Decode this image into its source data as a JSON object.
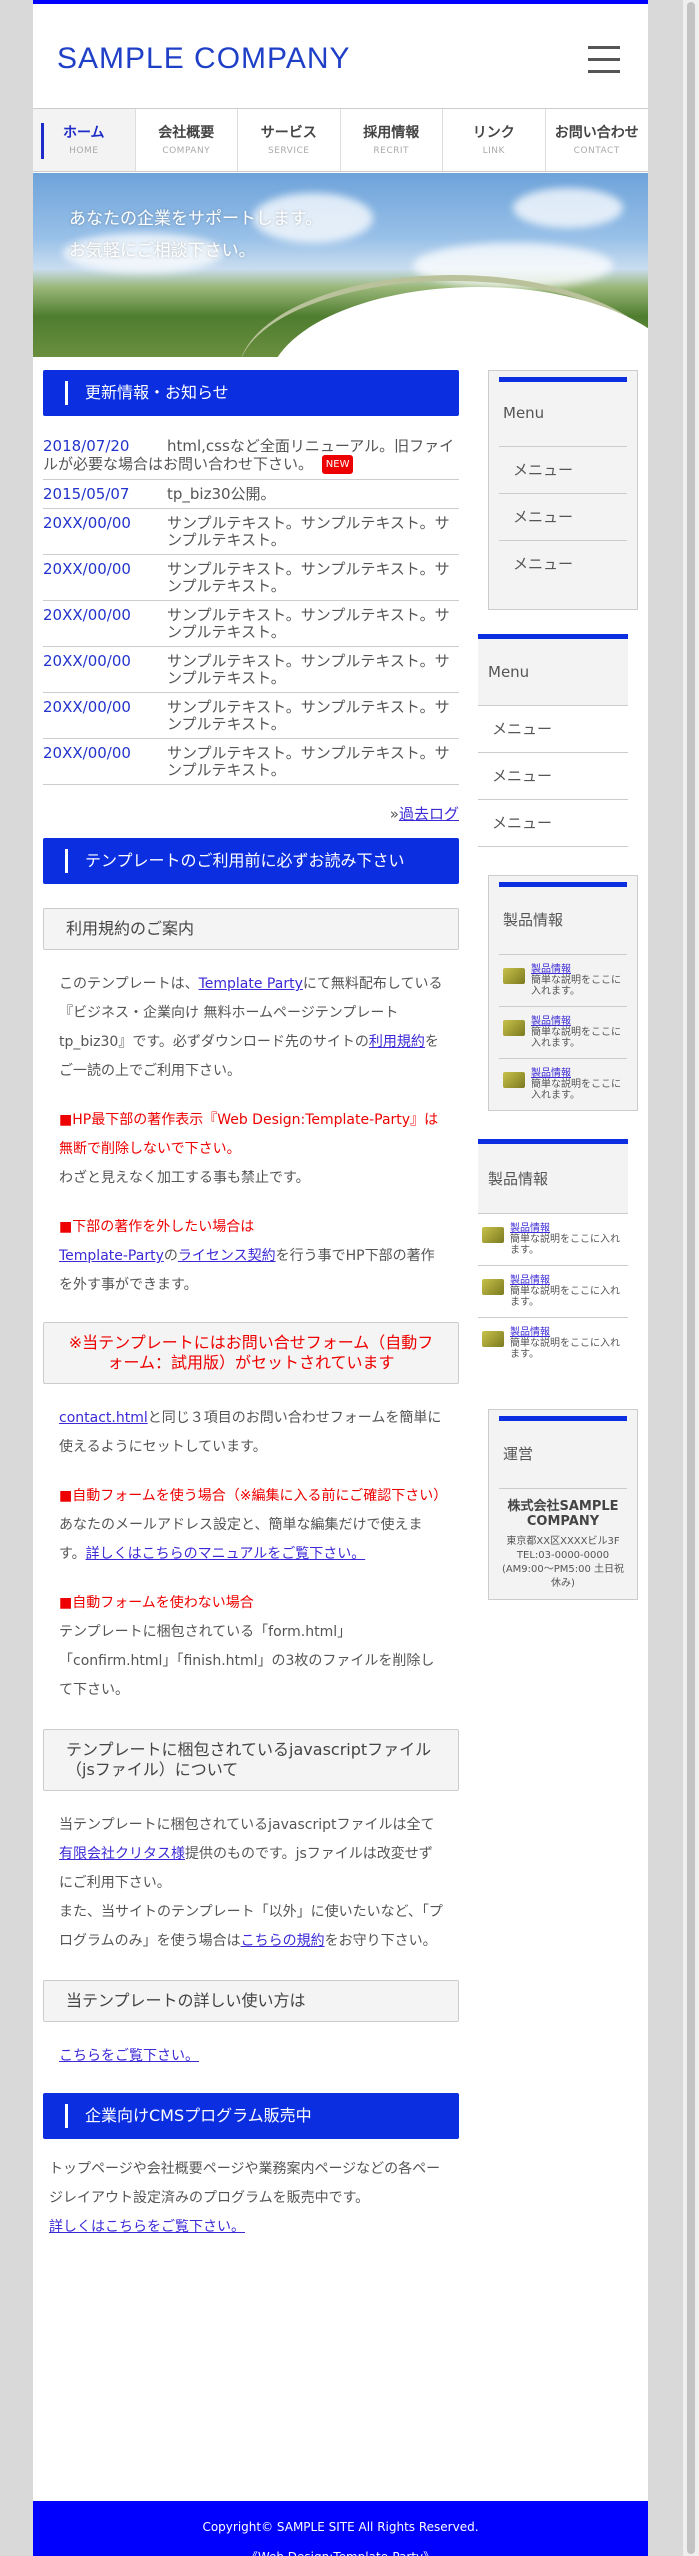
{
  "site": {
    "logo": "SAMPLE COMPANY"
  },
  "nav": [
    {
      "jp": "ホーム",
      "en": "HOME"
    },
    {
      "jp": "会社概要",
      "en": "COMPANY"
    },
    {
      "jp": "サービス",
      "en": "SERVICE"
    },
    {
      "jp": "採用情報",
      "en": "RECRIT"
    },
    {
      "jp": "リンク",
      "en": "LINK"
    },
    {
      "jp": "お問い合わせ",
      "en": "CONTACT"
    }
  ],
  "hero": {
    "line1": "あなたの企業をサポートします。",
    "line2": "お気軽にご相談下さい。"
  },
  "news": {
    "heading": "更新情報・お知らせ",
    "items": [
      {
        "date": "2018/07/20",
        "text": "html,cssなど全面リニューアル。旧ファイルが必要な場合はお問い合わせ下さい。",
        "badge": "NEW"
      },
      {
        "date": "2015/05/07",
        "text": "tp_biz30公開。"
      },
      {
        "date": "20XX/00/00",
        "text": "サンプルテキスト。サンプルテキスト。サンプルテキスト。"
      },
      {
        "date": "20XX/00/00",
        "text": "サンプルテキスト。サンプルテキスト。サンプルテキスト。"
      },
      {
        "date": "20XX/00/00",
        "text": "サンプルテキスト。サンプルテキスト。サンプルテキスト。"
      },
      {
        "date": "20XX/00/00",
        "text": "サンプルテキスト。サンプルテキスト。サンプルテキスト。"
      },
      {
        "date": "20XX/00/00",
        "text": "サンプルテキスト。サンプルテキスト。サンプルテキスト。"
      },
      {
        "date": "20XX/00/00",
        "text": "サンプルテキスト。サンプルテキスト。サンプルテキスト。"
      }
    ],
    "past_prefix": "»",
    "past_link": "過去ログ"
  },
  "template": {
    "heading": "テンプレートのご利用前に必ずお読み下さい",
    "terms_title": "利用規約のご案内",
    "terms_p1_a": "このテンプレートは、",
    "terms_p1_link": "Template Party",
    "terms_p1_b": "にて無料配布している『ビジネス・企業向け 無料ホームページテンプレート tp_biz30』です。必ずダウンロード先のサイトの",
    "terms_p1_link2": "利用規約",
    "terms_p1_c": "をご一読の上でご利用下さい。",
    "terms_red1": "■HP最下部の著作表示『Web Design:Template-Party』は無断で削除しないで下さい。",
    "terms_p2": "わざと見えなく加工する事も禁止です。",
    "terms_red2": "■下部の著作を外したい場合は",
    "terms_p3_link": "Template-Party",
    "terms_p3_a": "の",
    "terms_p3_link2": "ライセンス契約",
    "terms_p3_b": "を行う事でHP下部の著作を外す事ができます。",
    "form_title": "※当テンプレートにはお問い合せフォーム（自動フォーム：試用版）がセットされています",
    "form_p1_link": "contact.html",
    "form_p1": "と同じ３項目のお問い合わせフォームを簡単に使えるようにセットしています。",
    "form_red1": "■自動フォームを使う場合（※編集に入る前にご確認下さい）",
    "form_p2": "あなたのメールアドレス設定と、簡単な編集だけで使えます。",
    "form_p2_link": "詳しくはこちらのマニュアルをご覧下さい。",
    "form_red2": "■自動フォームを使わない場合",
    "form_p3": "テンプレートに梱包されている「form.html」「confirm.html」「finish.html」の3枚のファイルを削除して下さい。",
    "js_title": "テンプレートに梱包されているjavascriptファイル（jsファイル）について",
    "js_p_a": "当テンプレートに梱包されているjavascriptファイルは全て",
    "js_p_link": "有限会社クリタス様",
    "js_p_b": "提供のものです。jsファイルは改変せずにご利用下さい。",
    "js_p_c": "また、当サイトのテンプレート「以外」に使いたいなど、「プログラムのみ」を使う場合は",
    "js_p_link2": "こちらの規約",
    "js_p_d": "をお守り下さい。",
    "howto_title": "当テンプレートの詳しい使い方は",
    "howto_link": "こちらをご覧下さい。"
  },
  "cms": {
    "heading": "企業向けCMSプログラム販売中",
    "text": "トップページや会社概要ページや業務案内ページなどの各ページレイアウト設定済みのプログラムを販売中です。",
    "link": "詳しくはこちらをご覧下さい。"
  },
  "sidebar": {
    "menu1": {
      "title": "Menu",
      "items": [
        "メニュー",
        "メニュー",
        "メニュー"
      ]
    },
    "menu2": {
      "title": "Menu",
      "items": [
        "メニュー",
        "メニュー",
        "メニュー"
      ]
    },
    "products1": {
      "title": "製品情報",
      "items": [
        {
          "name": "製品情報",
          "desc": "簡単な説明をここに入れます。"
        },
        {
          "name": "製品情報",
          "desc": "簡単な説明をここに入れます。"
        },
        {
          "name": "製品情報",
          "desc": "簡単な説明をここに入れます。"
        }
      ]
    },
    "products2": {
      "title": "製品情報",
      "items": [
        {
          "name": "製品情報",
          "desc": "簡単な説明をここに入れます。"
        },
        {
          "name": "製品情報",
          "desc": "簡単な説明をここに入れます。"
        },
        {
          "name": "製品情報",
          "desc": "簡単な説明をここに入れます。"
        }
      ]
    },
    "company": {
      "title": "運営",
      "name": "株式会社SAMPLE COMPANY",
      "address": "東京都XX区XXXXビル3F",
      "tel": "TEL:03-0000-0000",
      "hours": "(AM9:00〜PM5:00 土日祝休み)"
    }
  },
  "footer": {
    "copyright": "Copyright© SAMPLE SITE All Rights Reserved.",
    "credit": "《Web Design:Template-Party》"
  },
  "colors": {
    "accent": "#0b2fe0",
    "footer": "#0000ff",
    "red": "#ee0000"
  }
}
